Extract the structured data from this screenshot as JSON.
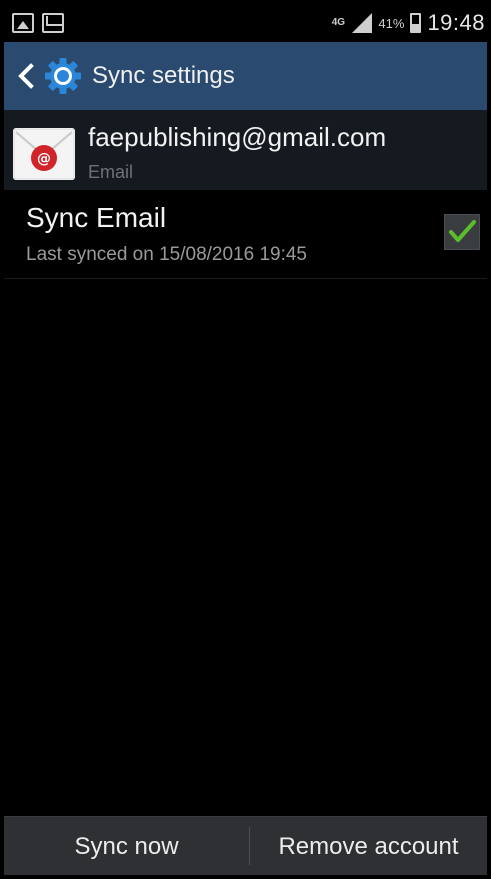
{
  "status_bar": {
    "network_type": "4G",
    "battery_percent": "41%",
    "time": "19:48",
    "left_icons": [
      "gallery-icon",
      "mail-icon"
    ]
  },
  "action_bar": {
    "title": "Sync settings",
    "back_icon": "chevron-left-icon",
    "app_icon": "gear-icon",
    "color": "#2a4a6f"
  },
  "account": {
    "email": "faepublishing@gmail.com",
    "type": "Email",
    "icon": "email-app-icon",
    "accent": "#d0242a"
  },
  "sync_items": [
    {
      "title": "Sync Email",
      "subtitle": "Last synced on 15/08/2016 19:45",
      "checked": true,
      "check_color": "#5bbd2b"
    }
  ],
  "bottom_actions": {
    "sync_now": "Sync now",
    "remove_account": "Remove account"
  }
}
